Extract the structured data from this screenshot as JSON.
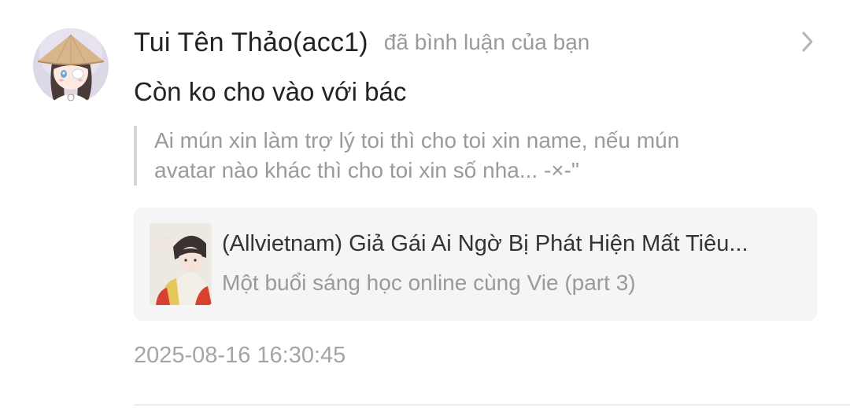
{
  "notification": {
    "user": {
      "name": "Tui Tên Thảo(acc1)",
      "avatar": "anime-girl-conical-hat-avatar"
    },
    "action_text": "đã bình luận của bạn",
    "comment": "Còn ko cho vào với bác",
    "quoted_comment": {
      "line1": "Ai mún xin làm trợ lý toi thì cho toi xin name, nếu mún",
      "line2": "avatar nào khác thì cho toi xin số nha... -×-\""
    },
    "story": {
      "title": "(Allvietnam) Giả Gái Ai Ngờ Bị Phát Hiện Mất Tiêu...",
      "chapter": "Một buổi sáng học online cùng Vie (part 3)",
      "cover": "anime-boy-cover-thumbnail"
    },
    "timestamp": "2025-08-16 16:30:45",
    "icons": {
      "open": "chevron-right-icon"
    }
  },
  "colors": {
    "primary_text": "#222222",
    "secondary_text": "#9a9a9a",
    "card_background": "#f5f5f5",
    "quote_bar": "#d6d6d6"
  }
}
